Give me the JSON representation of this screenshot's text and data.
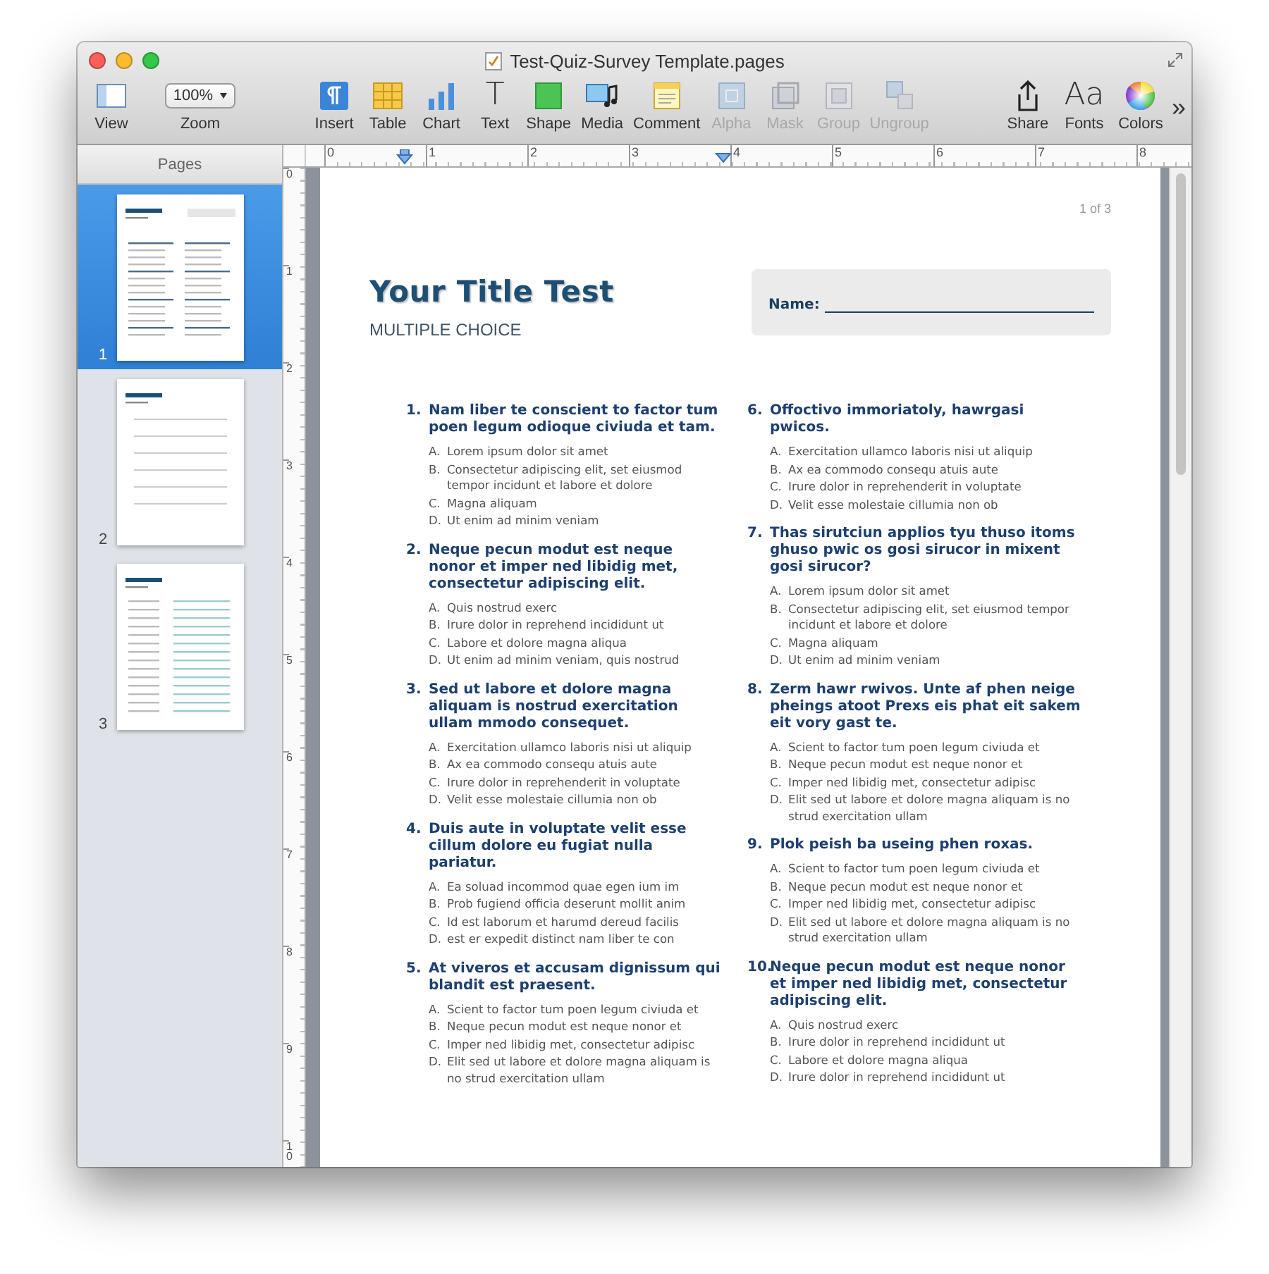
{
  "window": {
    "title": "Test-Quiz-Survey Template.pages"
  },
  "toolbar": {
    "left": [
      {
        "kind": "view",
        "label": "View",
        "disabled": false
      },
      {
        "kind": "popup",
        "label": "Zoom",
        "value": "100%"
      }
    ],
    "center": [
      {
        "kind": "insert",
        "label": "Insert",
        "disabled": false
      },
      {
        "kind": "table",
        "label": "Table",
        "disabled": false
      },
      {
        "kind": "chart",
        "label": "Chart",
        "disabled": false
      },
      {
        "kind": "glyph",
        "glyph": "T",
        "label": "Text",
        "disabled": false
      },
      {
        "kind": "shape",
        "label": "Shape",
        "disabled": false
      },
      {
        "kind": "media",
        "label": "Media",
        "disabled": false
      },
      {
        "kind": "comment",
        "label": "Comment",
        "disabled": false
      },
      {
        "kind": "alpha",
        "label": "Alpha",
        "disabled": true
      },
      {
        "kind": "mask",
        "label": "Mask",
        "disabled": true
      },
      {
        "kind": "group",
        "label": "Group",
        "disabled": true
      },
      {
        "kind": "ungroup",
        "label": "Ungroup",
        "disabled": true
      }
    ],
    "right": [
      {
        "kind": "share",
        "label": "Share",
        "disabled": false
      },
      {
        "kind": "glyph",
        "glyph": "Aa",
        "label": "Fonts",
        "disabled": false
      },
      {
        "kind": "colors",
        "label": "Colors",
        "disabled": false
      }
    ],
    "overflow": "»"
  },
  "sidebar": {
    "title": "Pages",
    "pages": [
      {
        "number": "1",
        "selected": true,
        "kind": "quiz"
      },
      {
        "number": "2",
        "selected": false,
        "kind": "lines"
      },
      {
        "number": "3",
        "selected": false,
        "kind": "grid"
      }
    ]
  },
  "ruler": {
    "horizontal": [
      "0",
      "1",
      "2",
      "3",
      "4",
      "5",
      "6",
      "7",
      "8"
    ],
    "vertical": [
      "0",
      "1",
      "2",
      "3",
      "4",
      "5",
      "6",
      "7",
      "8",
      "9",
      "10"
    ]
  },
  "page": {
    "page_number": "1 of 3",
    "title": "Your Title Test",
    "subtitle": "MULTIPLE CHOICE",
    "name_label": "Name:",
    "columns": [
      [
        {
          "number": "1.",
          "text": "Nam liber te conscient to factor tum poen legum odioque civiuda et tam.",
          "options": [
            {
              "letter": "A.",
              "text": "Lorem ipsum dolor sit amet"
            },
            {
              "letter": "B.",
              "text": "Consectetur adipiscing elit, set eiusmod tempor incidunt et labore et dolore"
            },
            {
              "letter": "C.",
              "text": "Magna aliquam"
            },
            {
              "letter": "D.",
              "text": "Ut enim ad minim veniam"
            }
          ]
        },
        {
          "number": "2.",
          "text": "Neque pecun modut est neque nonor et imper ned libidig met, consectetur adipiscing elit.",
          "options": [
            {
              "letter": "A.",
              "text": "Quis nostrud exerc"
            },
            {
              "letter": "B.",
              "text": "Irure dolor in reprehend incididunt ut"
            },
            {
              "letter": "C.",
              "text": "Labore et dolore magna aliqua"
            },
            {
              "letter": "D.",
              "text": "Ut enim ad minim veniam, quis nostrud"
            }
          ]
        },
        {
          "number": "3.",
          "text": "Sed ut labore et dolore magna aliquam is nostrud exercitation ullam mmodo consequet.",
          "options": [
            {
              "letter": "A.",
              "text": "Exercitation ullamco laboris nisi ut aliquip"
            },
            {
              "letter": "B.",
              "text": "Ax ea commodo consequ atuis aute"
            },
            {
              "letter": "C.",
              "text": "Irure dolor in reprehenderit in voluptate"
            },
            {
              "letter": "D.",
              "text": "Velit esse molestaie cillumia non ob"
            }
          ]
        },
        {
          "number": "4.",
          "text": "Duis aute in voluptate velit esse cillum dolore eu fugiat nulla pariatur.",
          "options": [
            {
              "letter": "A.",
              "text": "Ea soluad incommod quae egen ium im"
            },
            {
              "letter": "B.",
              "text": "Prob fugiend officia deserunt mollit anim"
            },
            {
              "letter": "C.",
              "text": "Id est laborum et harumd dereud facilis"
            },
            {
              "letter": "D.",
              "text": "est er expedit distinct nam liber te con"
            }
          ]
        },
        {
          "number": "5.",
          "text": "At viveros et accusam dignissum qui blandit est praesent.",
          "options": [
            {
              "letter": "A.",
              "text": "Scient to factor tum poen legum civiuda et"
            },
            {
              "letter": "B.",
              "text": "Neque pecun modut est neque nonor et"
            },
            {
              "letter": "C.",
              "text": "Imper ned libidig met, consectetur adipisc"
            },
            {
              "letter": "D.",
              "text": "Elit sed ut labore et dolore magna aliquam is no strud exercitation ullam"
            }
          ]
        }
      ],
      [
        {
          "number": "6.",
          "text": "Offoctivo immoriatoly, hawrgasi pwicos.",
          "options": [
            {
              "letter": "A.",
              "text": "Exercitation ullamco laboris nisi ut aliquip"
            },
            {
              "letter": "B.",
              "text": "Ax ea commodo consequ atuis aute"
            },
            {
              "letter": "C.",
              "text": "Irure dolor in reprehenderit in voluptate"
            },
            {
              "letter": "D.",
              "text": "Velit esse molestaie cillumia non ob"
            }
          ]
        },
        {
          "number": "7.",
          "text": "Thas sirutciun applios tyu thuso itoms ghuso pwic os gosi sirucor in mixent gosi sirucor?",
          "options": [
            {
              "letter": "A.",
              "text": "Lorem ipsum dolor sit amet"
            },
            {
              "letter": "B.",
              "text": "Consectetur adipiscing elit, set eiusmod tempor incidunt et labore et dolore"
            },
            {
              "letter": "C.",
              "text": "Magna aliquam"
            },
            {
              "letter": "D.",
              "text": "Ut enim ad minim veniam"
            }
          ]
        },
        {
          "number": "8.",
          "text": "Zerm hawr rwivos. Unte af phen neige pheings atoot Prexs eis phat eit sakem eit vory gast te.",
          "options": [
            {
              "letter": "A.",
              "text": "Scient to factor tum poen legum civiuda et"
            },
            {
              "letter": "B.",
              "text": "Neque pecun modut est neque nonor et"
            },
            {
              "letter": "C.",
              "text": "Imper ned libidig met, consectetur adipisc"
            },
            {
              "letter": "D.",
              "text": "Elit sed ut labore et dolore magna aliquam is no strud exercitation ullam"
            }
          ]
        },
        {
          "number": "9.",
          "text": "Plok peish ba useing phen roxas.",
          "options": [
            {
              "letter": "A.",
              "text": "Scient to factor tum poen legum civiuda et"
            },
            {
              "letter": "B.",
              "text": "Neque pecun modut est neque nonor et"
            },
            {
              "letter": "C.",
              "text": "Imper ned libidig met, consectetur adipisc"
            },
            {
              "letter": "D.",
              "text": "Elit sed ut labore et dolore magna aliquam is no strud exercitation ullam"
            }
          ]
        },
        {
          "number": "10.",
          "text": "Neque pecun modut est neque nonor et imper ned libidig met, consectetur adipiscing elit.",
          "options": [
            {
              "letter": "A.",
              "text": "Quis nostrud exerc"
            },
            {
              "letter": "B.",
              "text": "Irure dolor in reprehend incididunt ut"
            },
            {
              "letter": "C.",
              "text": "Labore et dolore magna aliqua"
            },
            {
              "letter": "D.",
              "text": "Irure dolor in reprehend incididunt ut"
            }
          ]
        }
      ]
    ]
  }
}
